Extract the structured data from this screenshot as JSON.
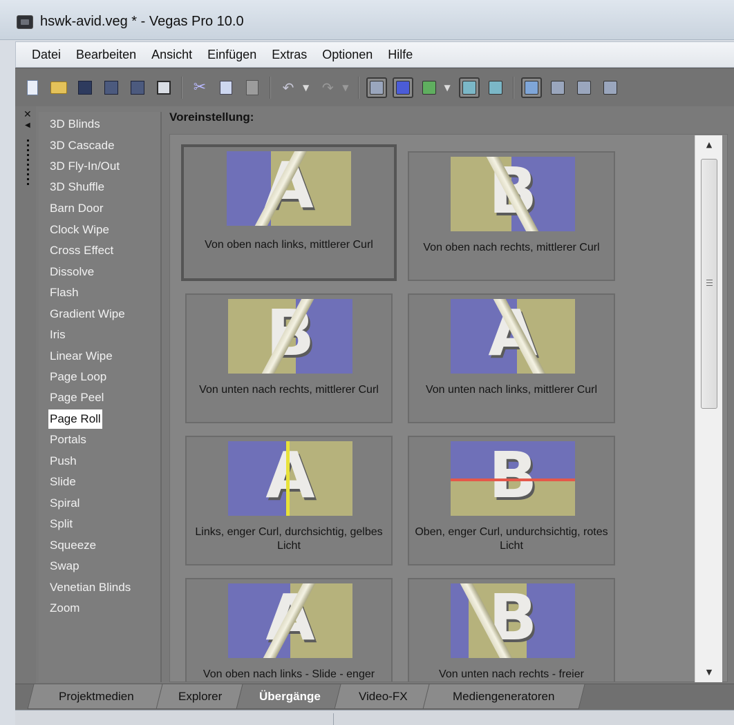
{
  "window": {
    "title": "hswk-avid.veg * - Vegas Pro 10.0"
  },
  "menu": [
    "Datei",
    "Bearbeiten",
    "Ansicht",
    "Einfügen",
    "Extras",
    "Optionen",
    "Hilfe"
  ],
  "toolbar": {
    "buttons": [
      "new-icon",
      "open-icon",
      "save-icon",
      "save-as-icon",
      "render-icon",
      "properties-icon",
      "cut-icon",
      "copy-icon",
      "paste-icon",
      "undo-icon",
      "redo-icon",
      "snapping-icon",
      "auto-ripple-icon",
      "lock-envelopes-icon",
      "ignore-grouping-icon",
      "autocrossfade-icon",
      "normal-edit-tool-icon",
      "envelope-tool-icon",
      "selection-tool-icon",
      "zoom-tool-icon"
    ]
  },
  "transitions": {
    "items": [
      "3D Blinds",
      "3D Cascade",
      "3D Fly-In/Out",
      "3D Shuffle",
      "Barn Door",
      "Clock Wipe",
      "Cross Effect",
      "Dissolve",
      "Flash",
      "Gradient Wipe",
      "Iris",
      "Linear Wipe",
      "Page Loop",
      "Page Peel",
      "Page Roll",
      "Portals",
      "Push",
      "Slide",
      "Spiral",
      "Split",
      "Squeeze",
      "Swap",
      "Venetian Blinds",
      "Zoom"
    ],
    "selected": "Page Roll"
  },
  "presets": {
    "heading": "Voreinstellung:",
    "items": [
      {
        "label": "Von oben nach links, mittlerer Curl",
        "letter": "A"
      },
      {
        "label": "Von oben nach rechts, mittlerer Curl",
        "letter": "B"
      },
      {
        "label": "Von unten nach rechts, mittlerer Curl",
        "letter": "B"
      },
      {
        "label": "Von unten nach links, mittlerer Curl",
        "letter": "A"
      },
      {
        "label": "Links, enger Curl, durchsichtig, gelbes Licht",
        "letter": "A"
      },
      {
        "label": "Oben, enger Curl, undurchsichtig, rotes Licht",
        "letter": "B"
      },
      {
        "label": "Von oben nach links - Slide - enger",
        "letter": "A"
      },
      {
        "label": "Von unten nach rechts - freier",
        "letter": "B"
      }
    ]
  },
  "tabs": {
    "items": [
      "Projektmedien",
      "Explorer",
      "Übergänge",
      "Video-FX",
      "Mediengeneratoren"
    ],
    "active": "Übergänge"
  },
  "colors": {
    "thumb_blue": "#6f70b8",
    "thumb_khaki": "#b6b27c",
    "yellow_light": "#e8e23a",
    "red_light": "#e4584a"
  }
}
